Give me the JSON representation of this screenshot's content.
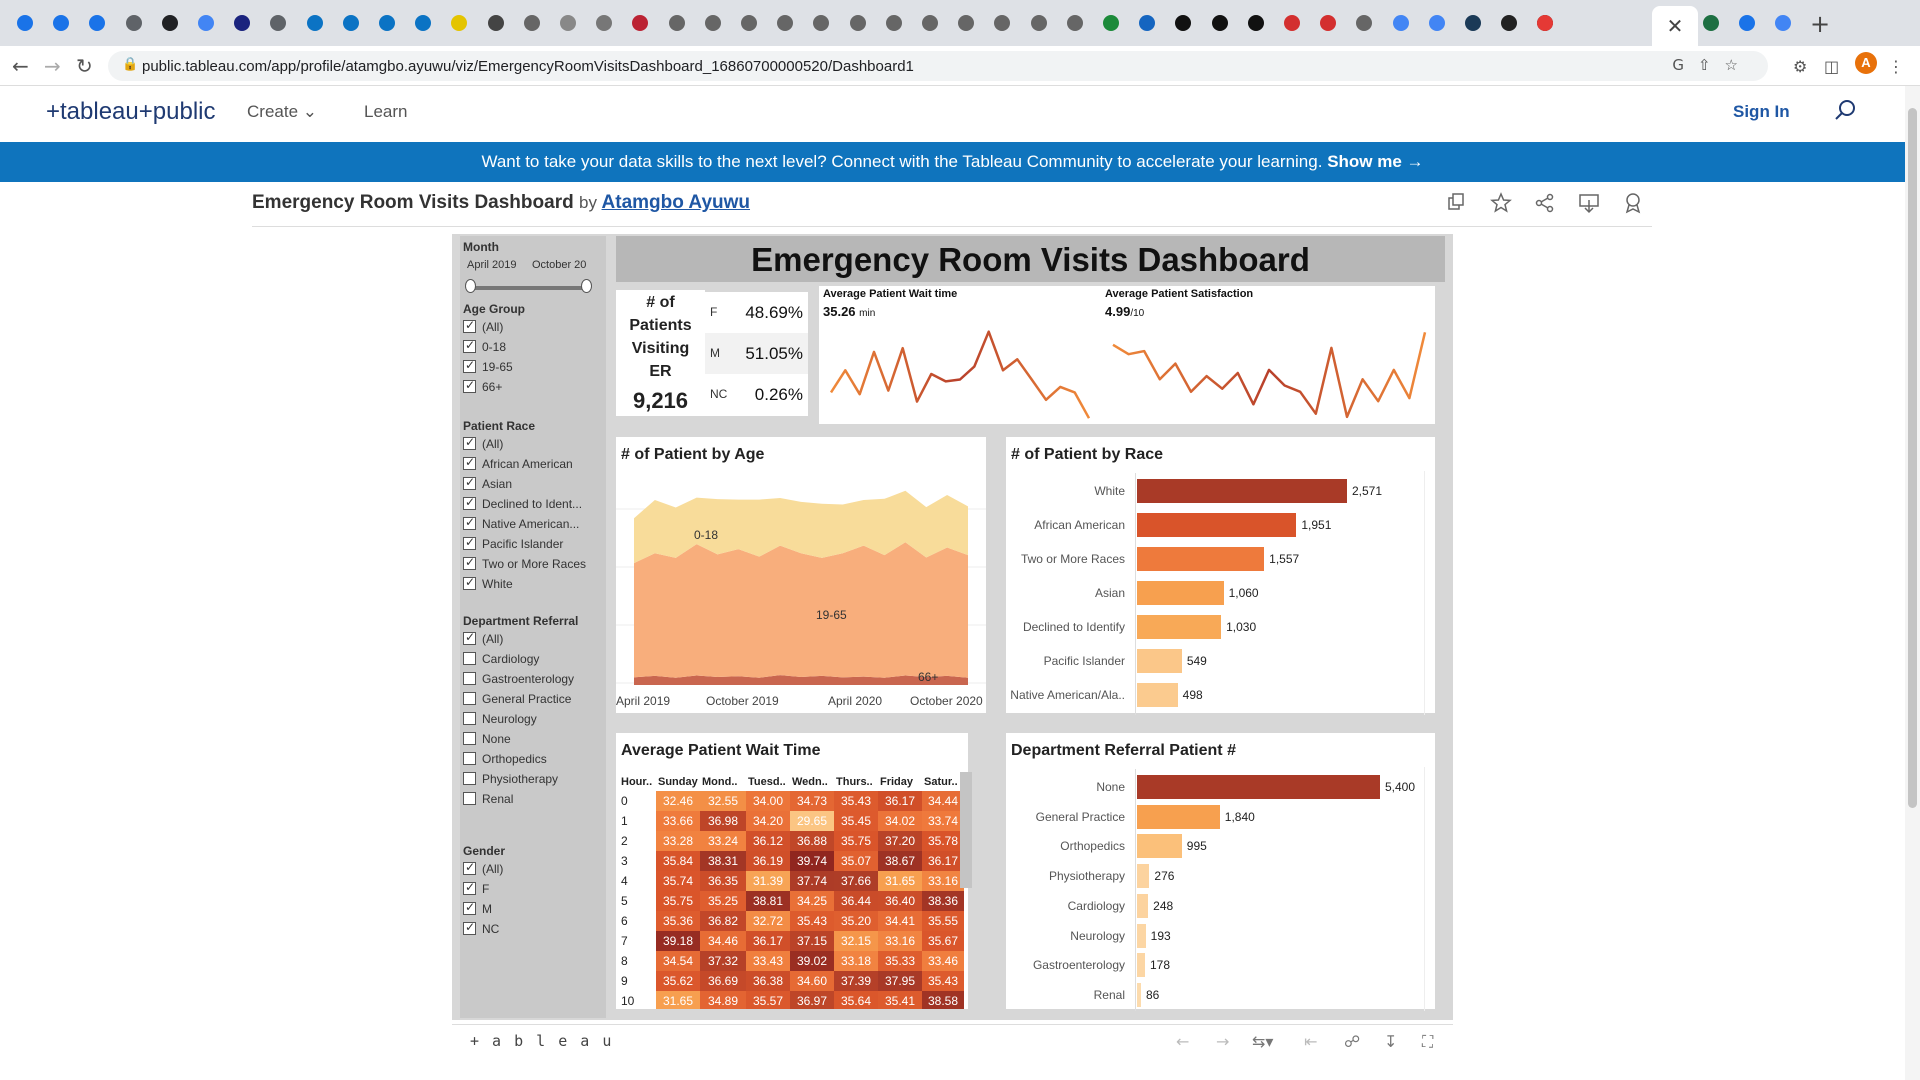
{
  "browser": {
    "url": "public.tableau.com/app/profile/atamgbo.ayuwu/viz/EmergencyRoomVisitsDashboard_16860700000520/Dashboard1",
    "avatar_letter": "A",
    "tab_close": "✕",
    "new_tab": "+"
  },
  "site": {
    "logo": "+tableau+public",
    "menu": [
      "Create",
      "Learn"
    ],
    "sign_in": "Sign In",
    "banner_text": "Want to take your data skills to the next level? Connect with the Tableau Community to accelerate your learning.",
    "banner_cta": "Show me →"
  },
  "viz": {
    "title": "Emergency Room Visits Dashboard",
    "by": "by",
    "author": "Atamgbo Ayuwu"
  },
  "filters": {
    "month": {
      "title": "Month",
      "from": "April 2019",
      "to": "October 20"
    },
    "age_group": {
      "title": "Age Group",
      "items": [
        "(All)",
        "0-18",
        "19-65",
        "66+"
      ],
      "checked": [
        true,
        true,
        true,
        true
      ]
    },
    "patient_race": {
      "title": "Patient Race",
      "items": [
        "(All)",
        "African American",
        "Asian",
        "Declined to Ident...",
        "Native American...",
        "Pacific Islander",
        "Two or More Races",
        "White"
      ],
      "checked": [
        true,
        true,
        true,
        true,
        true,
        true,
        true,
        true
      ]
    },
    "department_referral": {
      "title": "Department Referral",
      "items": [
        "(All)",
        "Cardiology",
        "Gastroenterology",
        "General Practice",
        "Neurology",
        "None",
        "Orthopedics",
        "Physiotherapy",
        "Renal"
      ],
      "checked": [
        true,
        false,
        false,
        false,
        false,
        false,
        false,
        false,
        false
      ]
    },
    "gender": {
      "title": "Gender",
      "items": [
        "(All)",
        "F",
        "M",
        "NC"
      ],
      "checked": [
        true,
        true,
        true,
        true
      ]
    }
  },
  "dashboard": {
    "title": "Emergency Room Visits Dashboard",
    "kpi_title_lines": [
      "# of",
      "Patients",
      "Visiting",
      "ER"
    ],
    "kpi_value": "9,216",
    "gender_split": [
      {
        "key": "F",
        "pct": "48.69%"
      },
      {
        "key": "M",
        "pct": "51.05%"
      },
      {
        "key": "NC",
        "pct": "0.26%"
      }
    ],
    "wait_spark": {
      "title": "Average Patient Wait time",
      "value": "35.26",
      "unit": "min"
    },
    "sat_spark": {
      "title": "Average Patient Satisfaction",
      "value": "4.99",
      "unit": "/10"
    }
  },
  "chart_data": [
    {
      "type": "line",
      "title": "Average Patient Wait time",
      "x_count": 19,
      "series": [
        {
          "values": [
            35.0,
            36.2,
            34.9,
            37.2,
            35.1,
            37.4,
            34.5,
            36.0,
            35.6,
            35.7,
            36.4,
            38.3,
            36.2,
            36.8,
            35.7,
            34.6,
            35.3,
            35.0,
            33.6
          ]
        }
      ]
    },
    {
      "type": "line",
      "title": "Average Patient Satisfaction",
      "x_count": 21,
      "series": [
        {
          "values": [
            5.45,
            5.3,
            5.35,
            4.9,
            5.15,
            4.7,
            4.95,
            4.75,
            5.0,
            4.5,
            5.05,
            4.8,
            4.7,
            4.35,
            5.4,
            4.3,
            4.9,
            4.55,
            5.05,
            4.6,
            5.65
          ]
        }
      ]
    },
    {
      "type": "area",
      "title": "# of Patient by Age",
      "x_ticks": [
        "April 2019",
        "October 2019",
        "April 2020",
        "October 2020"
      ],
      "annotations": [
        "0-18",
        "19-65",
        "66+"
      ],
      "series": [
        {
          "name": "66+",
          "values": [
            20,
            24,
            19,
            25,
            21,
            23,
            19,
            26,
            21,
            24,
            20,
            22,
            19,
            25,
            21,
            24,
            19
          ]
        },
        {
          "name": "19-65",
          "values": [
            300,
            322,
            315,
            345,
            322,
            334,
            318,
            340,
            325,
            310,
            326,
            344,
            322,
            350,
            314,
            337,
            322
          ]
        },
        {
          "name": "0-18",
          "values": [
            118,
            140,
            132,
            122,
            145,
            130,
            150,
            125,
            135,
            142,
            128,
            120,
            148,
            135,
            132,
            138,
            128
          ]
        }
      ]
    },
    {
      "type": "bar",
      "title": "# of Patient by Race",
      "categories": [
        "White",
        "African American",
        "Two or More Races",
        "Asian",
        "Declined to Identify",
        "Pacific Islander",
        "Native American/Ala.."
      ],
      "values": [
        2571,
        1951,
        1557,
        1060,
        1030,
        549,
        498
      ],
      "labels": [
        "2,571",
        "1,951",
        "1,557",
        "1,060",
        "1,030",
        "549",
        "498"
      ],
      "colors": [
        "#a93a27",
        "#d9542a",
        "#ee7a3c",
        "#f7a04f",
        "#f8a957",
        "#fbc789",
        "#fbcb8f"
      ]
    },
    {
      "type": "heatmap",
      "title": "Average Patient Wait Time",
      "row_header": "Hour..",
      "columns": [
        "Sunday",
        "Mond..",
        "Tuesd..",
        "Wedn..",
        "Thurs..",
        "Friday",
        "Satur.."
      ],
      "rows": [
        "0",
        "1",
        "2",
        "3",
        "4",
        "5",
        "6",
        "7",
        "8",
        "9",
        "10"
      ],
      "values": [
        [
          "32.46",
          "32.55",
          "34.00",
          "34.73",
          "35.43",
          "36.17",
          "34.44"
        ],
        [
          "33.66",
          "36.98",
          "34.20",
          "29.65",
          "35.45",
          "34.02",
          "33.74"
        ],
        [
          "33.28",
          "33.24",
          "36.12",
          "36.88",
          "35.75",
          "37.20",
          "35.78"
        ],
        [
          "35.84",
          "38.31",
          "36.19",
          "39.74",
          "35.07",
          "38.67",
          "36.17"
        ],
        [
          "35.74",
          "36.35",
          "31.39",
          "37.74",
          "37.66",
          "31.65",
          "33.16"
        ],
        [
          "35.75",
          "35.25",
          "38.81",
          "34.25",
          "36.44",
          "36.40",
          "38.36"
        ],
        [
          "35.36",
          "36.82",
          "32.72",
          "35.43",
          "35.20",
          "34.41",
          "35.55"
        ],
        [
          "39.18",
          "34.46",
          "36.17",
          "37.15",
          "32.15",
          "33.16",
          "35.67"
        ],
        [
          "34.54",
          "37.32",
          "33.43",
          "39.02",
          "33.18",
          "35.33",
          "33.46"
        ],
        [
          "35.62",
          "36.69",
          "36.38",
          "34.60",
          "37.39",
          "37.95",
          "35.43"
        ],
        [
          "31.65",
          "34.89",
          "35.57",
          "36.97",
          "35.64",
          "35.41",
          "38.58"
        ]
      ]
    },
    {
      "type": "bar",
      "title": "Department Referral Patient #",
      "categories": [
        "None",
        "General Practice",
        "Orthopedics",
        "Physiotherapy",
        "Cardiology",
        "Neurology",
        "Gastroenterology",
        "Renal"
      ],
      "values": [
        5400,
        1840,
        995,
        276,
        248,
        193,
        178,
        86
      ],
      "labels": [
        "5,400",
        "1,840",
        "995",
        "276",
        "248",
        "193",
        "178",
        "86"
      ],
      "colors": [
        "#a93a27",
        "#f7a04f",
        "#fbc07a",
        "#fcd39f",
        "#fcd39f",
        "#fcd6a4",
        "#fcd6a4",
        "#fcdbad"
      ]
    }
  ],
  "footer": {
    "logo": "+ a b l e a u"
  }
}
